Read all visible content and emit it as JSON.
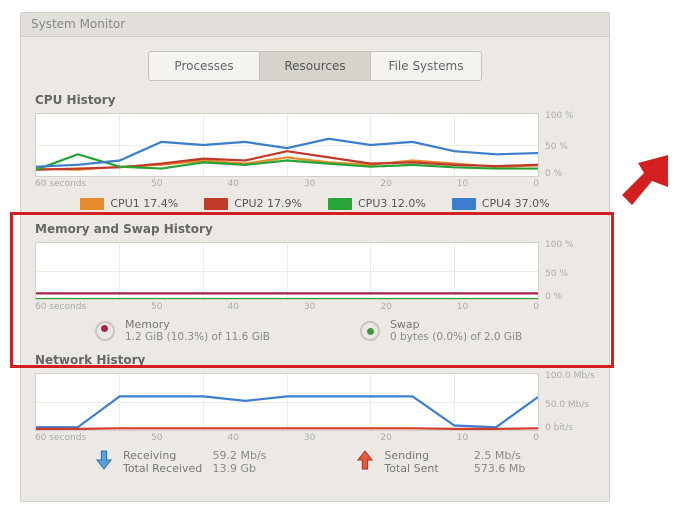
{
  "window": {
    "title": "System Monitor"
  },
  "tabs": {
    "processes": "Processes",
    "resources": "Resources",
    "filesystems": "File Systems",
    "active": "resources"
  },
  "cpu": {
    "title": "CPU History",
    "yaxis": [
      "100 %",
      "50 %",
      "0 %"
    ],
    "xaxis": [
      "60 seconds",
      "50",
      "40",
      "30",
      "20",
      "10",
      "0"
    ],
    "legend": [
      {
        "name": "CPU1",
        "value": "17.4%",
        "color": "#e78b2f"
      },
      {
        "name": "CPU2",
        "value": "17.9%",
        "color": "#c0392b"
      },
      {
        "name": "CPU3",
        "value": "12.0%",
        "color": "#2aa336"
      },
      {
        "name": "CPU4",
        "value": "37.0%",
        "color": "#3b7ecb"
      }
    ]
  },
  "memory": {
    "title": "Memory and Swap History",
    "yaxis": [
      "100 %",
      "50 %",
      "0 %"
    ],
    "xaxis": [
      "60 seconds",
      "50",
      "40",
      "30",
      "20",
      "10",
      "0"
    ],
    "mem_label": "Memory",
    "mem_value": "1.2 GiB (10.3%) of 11.6 GiB",
    "swap_label": "Swap",
    "swap_value": "0 bytes (0.0%) of 2.0 GiB"
  },
  "network": {
    "title": "Network History",
    "yaxis": [
      "100.0 Mb/s",
      "50.0 Mb/s",
      "0 bit/s"
    ],
    "xaxis": [
      "60 seconds",
      "50",
      "40",
      "30",
      "20",
      "10",
      "0"
    ],
    "recv_label": "Receiving",
    "recv_rate": "59.2 Mb/s",
    "recv_total_label": "Total Received",
    "recv_total": "13.9 Gb",
    "send_label": "Sending",
    "send_rate": "2.5 Mb/s",
    "send_total_label": "Total Sent",
    "send_total": "573.6 Mb"
  },
  "chart_data": [
    {
      "type": "line",
      "title": "CPU History",
      "xlabel": "seconds",
      "ylabel": "%",
      "x": [
        60,
        55,
        50,
        45,
        40,
        35,
        30,
        25,
        20,
        15,
        10,
        5,
        0
      ],
      "xlim": [
        60,
        0
      ],
      "ylim": [
        0,
        100
      ],
      "series": [
        {
          "name": "CPU1",
          "color": "#e78b2f",
          "values": [
            12,
            10,
            15,
            18,
            25,
            20,
            30,
            22,
            18,
            25,
            20,
            15,
            17
          ]
        },
        {
          "name": "CPU2",
          "color": "#c0392b",
          "values": [
            10,
            12,
            14,
            20,
            28,
            25,
            40,
            30,
            20,
            22,
            18,
            16,
            18
          ]
        },
        {
          "name": "CPU3",
          "color": "#2aa336",
          "values": [
            10,
            35,
            15,
            12,
            22,
            18,
            25,
            20,
            15,
            18,
            14,
            12,
            12
          ]
        },
        {
          "name": "CPU4",
          "color": "#3b7ecb",
          "values": [
            15,
            18,
            25,
            55,
            50,
            55,
            45,
            60,
            50,
            55,
            40,
            35,
            37
          ]
        }
      ]
    },
    {
      "type": "line",
      "title": "Memory and Swap History",
      "xlabel": "seconds",
      "ylabel": "%",
      "x": [
        60,
        50,
        40,
        30,
        20,
        10,
        0
      ],
      "xlim": [
        60,
        0
      ],
      "ylim": [
        0,
        100
      ],
      "series": [
        {
          "name": "Memory",
          "color": "#a2254a",
          "values": [
            10,
            10,
            10,
            10,
            10,
            10,
            10
          ]
        },
        {
          "name": "Swap",
          "color": "#2aa336",
          "values": [
            0,
            0,
            0,
            0,
            0,
            0,
            0
          ]
        }
      ]
    },
    {
      "type": "line",
      "title": "Network History",
      "xlabel": "seconds",
      "ylabel": "Mb/s",
      "x": [
        60,
        55,
        50,
        45,
        40,
        35,
        30,
        25,
        20,
        15,
        10,
        5,
        0
      ],
      "xlim": [
        60,
        0
      ],
      "ylim": [
        0,
        100
      ],
      "series": [
        {
          "name": "Receiving",
          "color": "#3b7ecb",
          "values": [
            5,
            5,
            60,
            60,
            60,
            52,
            60,
            60,
            60,
            60,
            8,
            5,
            59
          ]
        },
        {
          "name": "Sending",
          "color": "#d23b2a",
          "values": [
            2,
            2,
            3,
            3,
            3,
            3,
            3,
            3,
            3,
            3,
            2,
            2,
            3
          ]
        }
      ]
    }
  ]
}
